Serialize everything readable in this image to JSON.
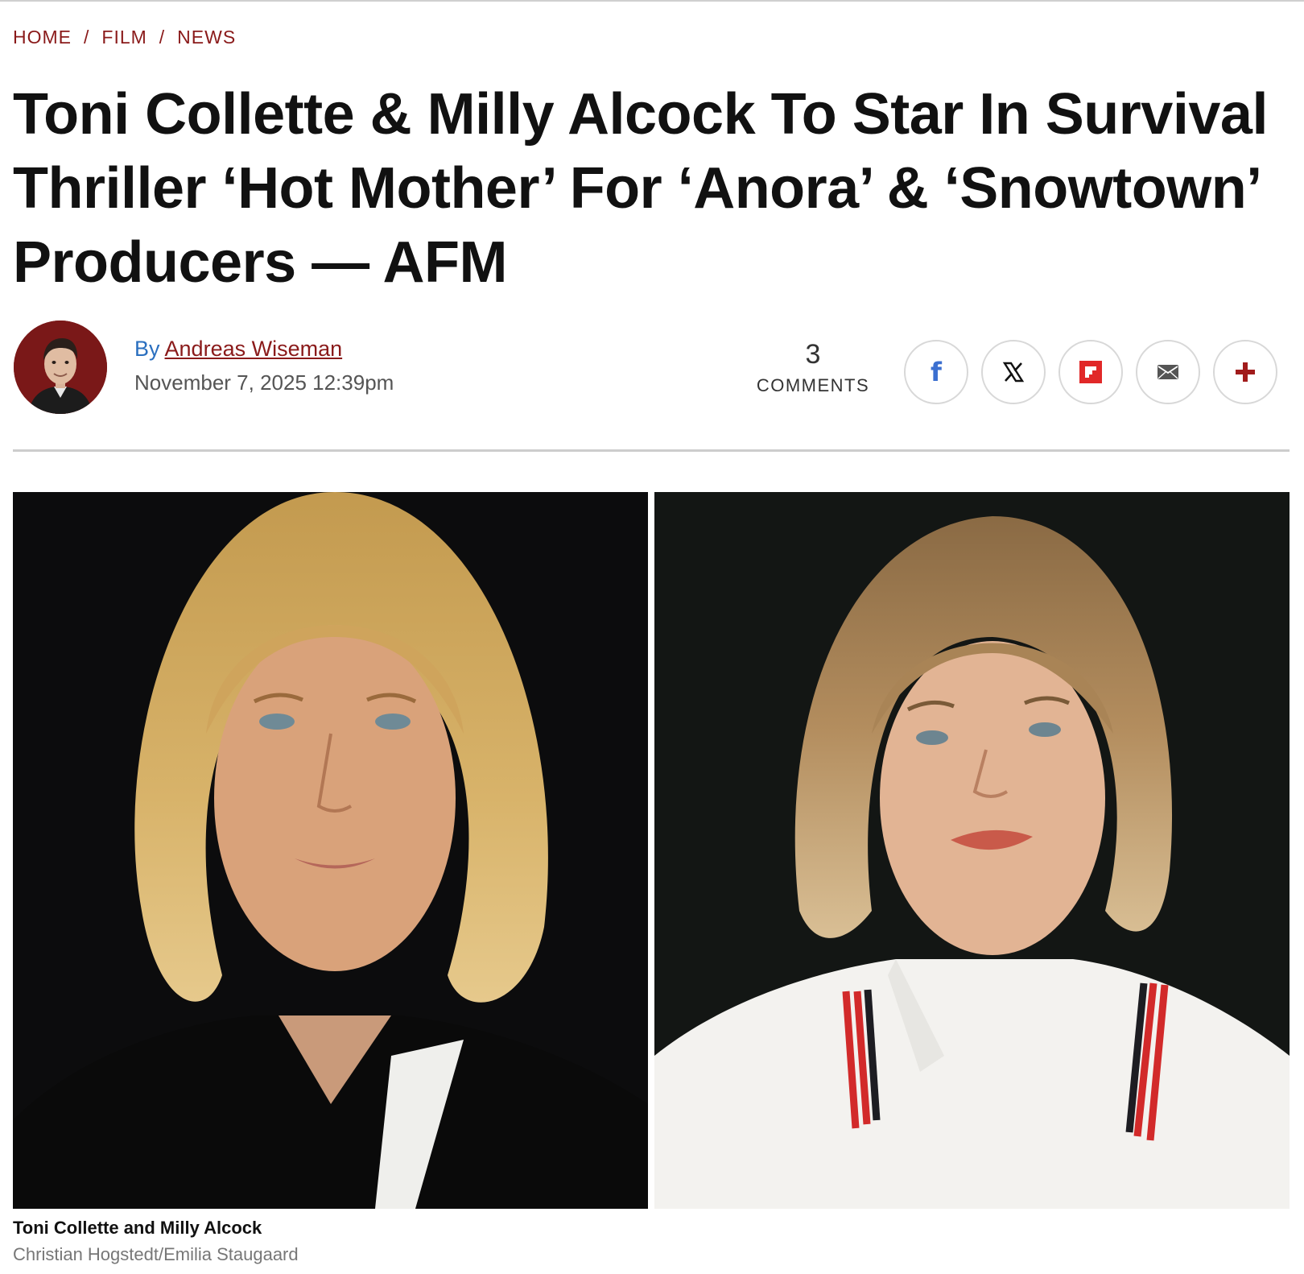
{
  "breadcrumb": {
    "items": [
      "HOME",
      "FILM",
      "NEWS"
    ],
    "separator": "/"
  },
  "article": {
    "headline": "Toni Collette & Milly Alcock To Star In Survival Thriller ‘Hot Mother’ For ‘Anora’ & ‘Snowtown’ Producers — AFM",
    "byline_prefix": "By",
    "author": "Andreas Wiseman",
    "date": "November 7, 2025 12:39pm",
    "comments_count": "3",
    "comments_label": "COMMENTS"
  },
  "share": {
    "icons": [
      "facebook-icon",
      "x-icon",
      "flipboard-icon",
      "email-icon",
      "more-plus-icon"
    ],
    "facebook_glyph": "f",
    "colors": {
      "facebook": "#3b6fd0",
      "x": "#111111",
      "flipboard": "#e12828",
      "email": "#555555",
      "plus": "#a11b1b"
    }
  },
  "media": {
    "caption": "Toni Collette and Milly Alcock",
    "credit": "Christian Hogstedt/Emilia Staugaard"
  },
  "colors": {
    "accent": "#8a1a1a",
    "link_blue": "#2a6fbf",
    "divider": "#cdcdcd"
  }
}
